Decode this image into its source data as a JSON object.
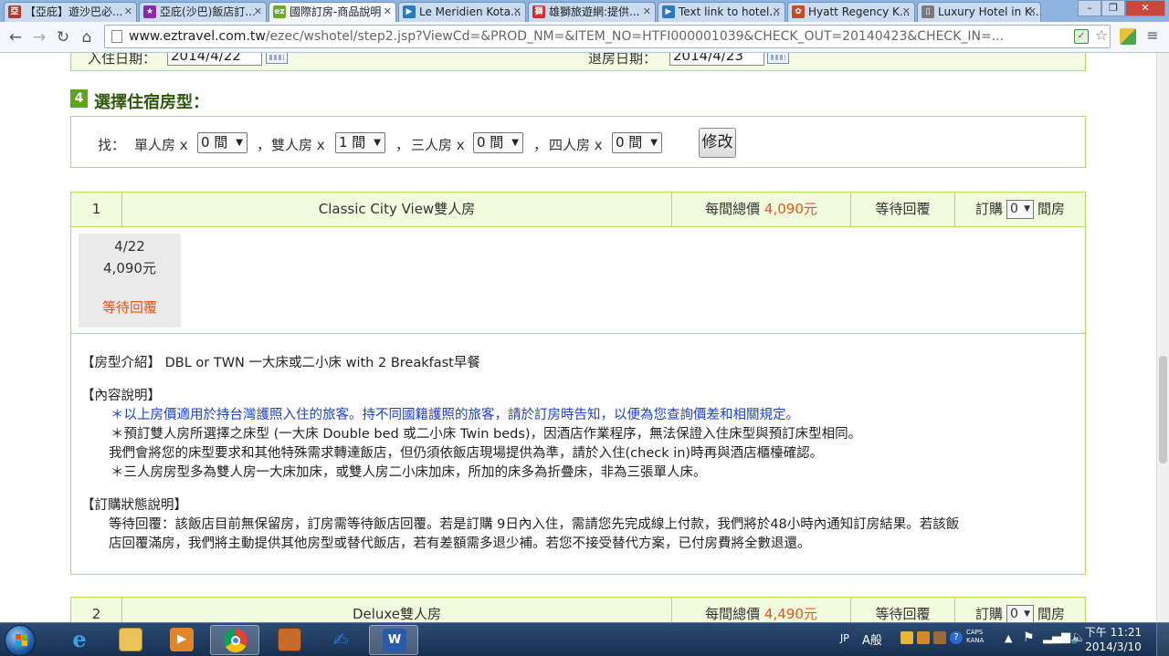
{
  "browser": {
    "tabs": [
      {
        "title": "【亞庇】遊沙巴必...",
        "fav": "亞",
        "color": "#b23a2c"
      },
      {
        "title": "亞庇(沙巴)飯店訂...",
        "fav": "★",
        "color": "#8a2aa8"
      },
      {
        "title": "國際訂房-商品說明",
        "fav": "ez",
        "color": "#6aae1e"
      },
      {
        "title": "Le Meridien Kota...",
        "fav": "▶",
        "color": "#2a7ac0"
      },
      {
        "title": "雄獅旅遊網:提供...",
        "fav": "獅",
        "color": "#d32f2f"
      },
      {
        "title": "Text link to hotel...",
        "fav": "▶",
        "color": "#2a7ac0"
      },
      {
        "title": "Hyatt Regency K...",
        "fav": "✿",
        "color": "#c44a2a"
      },
      {
        "title": "Luxury Hotel in K...",
        "fav": "▯",
        "color": "#7a7a7a"
      }
    ],
    "active_tab_index": 2,
    "url_host": "www.eztravel.com.tw",
    "url_path": "/ezec/wshotel/step2.jsp?ViewCd=&PROD_NM=&ITEM_NO=HTFI000001039&CHECK_OUT=20140423&CHECK_IN=..."
  },
  "dates": {
    "checkin_label": "入住日期：",
    "checkin_value": "2014/4/22",
    "checkout_label": "退房日期：",
    "checkout_value": "2014/4/23"
  },
  "section": {
    "number": "4",
    "title": "選擇住宿房型："
  },
  "search": {
    "prefix": "找：",
    "single_label": "單人房 x",
    "single_value": "0 間",
    "sep1": "，",
    "double_label": "雙人房 x",
    "double_value": "1 間",
    "sep2": "，",
    "triple_label": "三人房 x",
    "triple_value": "0 間",
    "sep3": "，",
    "quad_label": "四人房 x",
    "quad_value": "0 間",
    "modify_label": "修改"
  },
  "rooms": [
    {
      "index": "1",
      "name": "Classic City View雙人房",
      "price_label": "每間總價",
      "price": "4,090元",
      "status": "等待回覆",
      "order_label": "訂購",
      "order_value": "0",
      "order_unit": "間房",
      "day_date": "4/22",
      "day_price": "4,090元",
      "day_status": "等待回覆",
      "intro": "【房型介紹】 DBL or TWN 一大床或二小床 with 2 Breakfast早餐",
      "content_title": "【內容說明】",
      "content_lines": [
        "＊以上房價適用於持台灣護照入住的旅客。持不同國籍護照的旅客，請於訂房時告知，以便為您查詢價差和相關規定。",
        "＊預訂雙人房所選擇之床型 (一大床 Double bed 或二小床 Twin beds)，因酒店作業程序，無法保證入住床型與預訂床型相同。",
        "我們會將您的床型要求和其他特殊需求轉達飯店，但仍須依飯店現場提供為準，請於入住(check in)時再與酒店櫃檯確認。",
        "＊三人房房型多為雙人房一大床加床，或雙人房二小床加床，所加的床多為折疊床，非為三張單人床。"
      ],
      "status_title": "【訂購狀態說明】",
      "status_lines": [
        "等待回覆：該飯店目前無保留房，訂房需等待飯店回覆。若是訂購 9日內入住，需請您先完成線上付款，我們將於48小時內通知訂房結果。若該飯",
        "店回覆滿房，我們將主動提供其他房型或替代飯店，若有差額需多退少補。若您不接受替代方案，已付房費將全數退還。"
      ]
    },
    {
      "index": "2",
      "name": "Deluxe雙人房",
      "price_label": "每間總價",
      "price": "4,490元",
      "status": "等待回覆",
      "order_label": "訂購",
      "order_value": "0",
      "order_unit": "間房"
    }
  ],
  "taskbar": {
    "lang": "JP",
    "ime": "A般",
    "caps": "CAPS",
    "kana": "KANA",
    "time": "下午 11:21",
    "date": "2014/3/10"
  }
}
